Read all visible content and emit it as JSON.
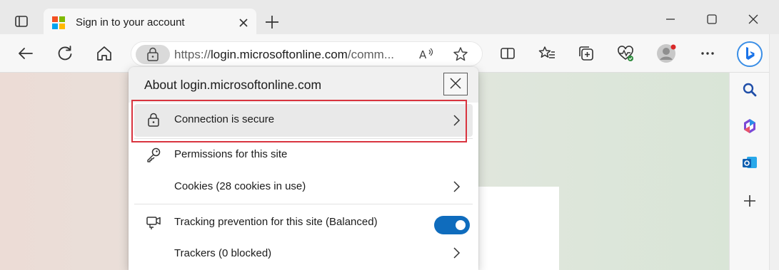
{
  "browser": {
    "tab": {
      "title": "Sign in to your account",
      "favicon_colors": [
        "#f25022",
        "#7fba00",
        "#00a4ef",
        "#ffb900"
      ]
    },
    "address_bar": {
      "url_prefix": "https://",
      "url_host": "login.microsoftonline.com",
      "url_rest": "/comm..."
    },
    "accent_color": "#0f6cbd"
  },
  "icons": {
    "tab_actions": "tab-actions-icon",
    "new_tab": "plus-icon",
    "back": "back-arrow-icon",
    "refresh": "refresh-icon",
    "home": "home-icon",
    "lock": "lock-icon",
    "read_aloud": "read-aloud-icon",
    "favorite": "star-icon",
    "split_screen": "split-screen-icon",
    "favorites": "favorites-icon",
    "collections": "collections-icon",
    "browser_essentials": "heart-pulse-icon",
    "profile": "profile-icon",
    "more": "more-icon",
    "copilot": "bing-icon",
    "search": "search-icon",
    "office": "microsoft365-icon",
    "outlook": "outlook-icon",
    "add": "plus-icon"
  },
  "flyout": {
    "title": "About login.microsoftonline.com",
    "connection_label": "Connection is secure",
    "permissions_label": "Permissions for this site",
    "cookies_label": "Cookies (28 cookies in use)",
    "tracking_label": "Tracking prevention for this site (Balanced)",
    "tracking_enabled": true,
    "trackers_label": "Trackers (0 blocked)"
  }
}
